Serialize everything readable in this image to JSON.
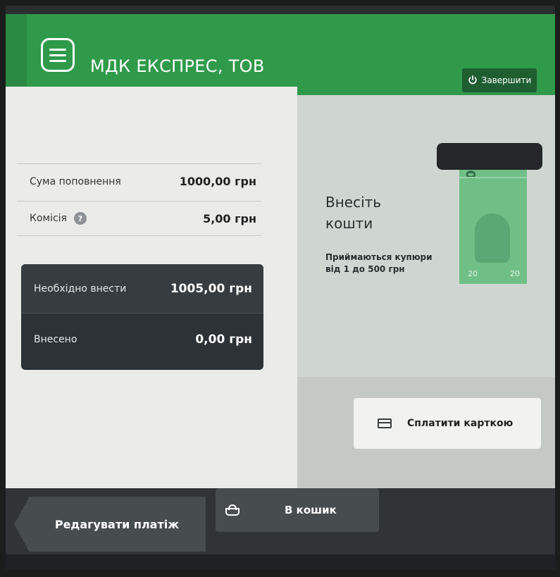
{
  "header": {
    "company": "МДК ЕКСПРЕС, ТОВ",
    "exit_label": "Завершити",
    "menu_icon": "menu-icon",
    "exit_icon": "power-icon",
    "color": "#2f9a4a"
  },
  "summary": {
    "amount_label": "Сума поповнення",
    "amount_value": "1000,00 грн",
    "fee_label": "Комісія",
    "fee_value": "5,00 грн",
    "due_label": "Необхідно внести",
    "due_value": "1005,00 грн",
    "paid_label": "Внесено",
    "paid_value": "0,00 грн"
  },
  "deposit": {
    "title_line1": "Внесіть",
    "title_line2": "кошти",
    "hint_line1": "Приймаються купюри",
    "hint_line2": "від 1 до 500 грн",
    "bill_denomination": "20"
  },
  "card_payment": {
    "label": "Сплатити карткою",
    "icon": "credit-card-icon"
  },
  "footer": {
    "edit_label": "Редагувати платіж",
    "cart_label": "В кошик",
    "cart_icon": "basket-icon"
  }
}
